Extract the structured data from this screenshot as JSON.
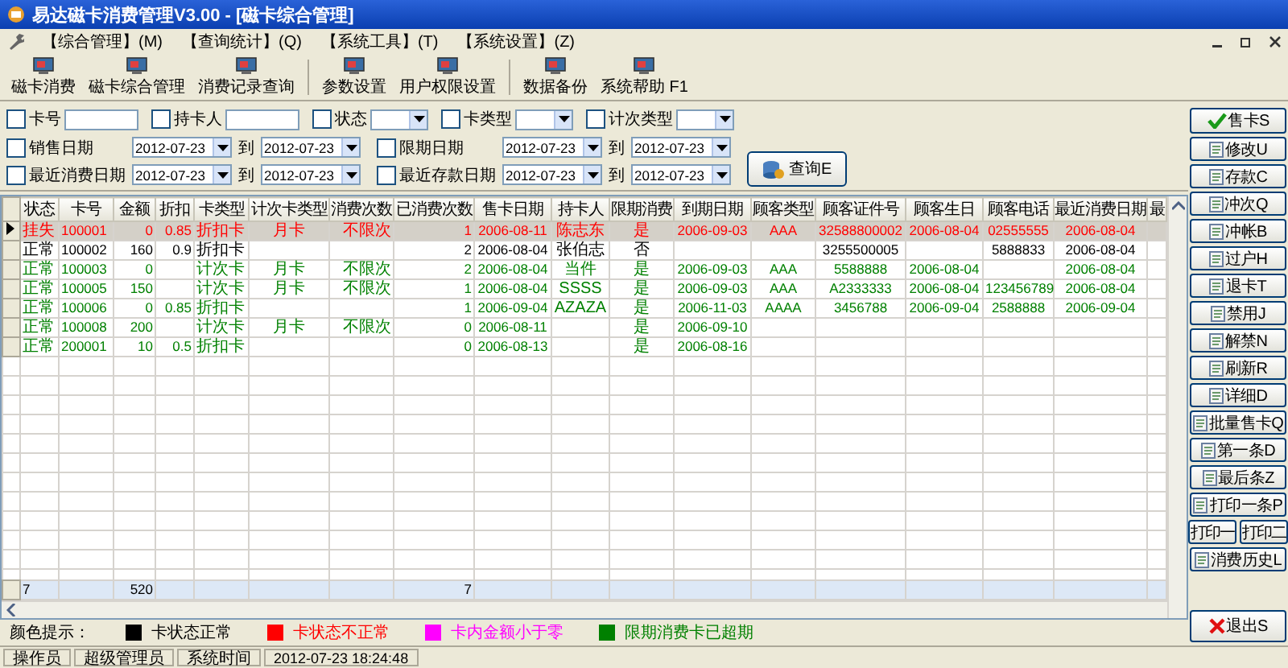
{
  "window": {
    "title": "易达磁卡消费管理V3.00 - [磁卡综合管理]"
  },
  "menu": [
    "【综合管理】(M)",
    "【查询统计】(Q)",
    "【系统工具】(T)",
    "【系统设置】(Z)"
  ],
  "toolbar_groups": [
    {
      "items": [
        "磁卡消费",
        "磁卡综合管理",
        "消费记录查询"
      ]
    },
    {
      "items": [
        "参数设置",
        "用户权限设置"
      ]
    },
    {
      "items": [
        "数据备份",
        "系统帮助 F1"
      ]
    }
  ],
  "filters": [
    {
      "kind": "text",
      "label": "卡号",
      "checked": false
    },
    {
      "kind": "text",
      "label": "持卡人",
      "checked": false
    },
    {
      "kind": "combo",
      "label": "状态",
      "checked": false
    },
    {
      "kind": "combo",
      "label": "卡类型",
      "checked": false
    },
    {
      "kind": "combo",
      "label": "计次类型",
      "checked": false
    }
  ],
  "date_filters": [
    {
      "label": "销售日期",
      "checked": false,
      "from": "2012-07-23",
      "to_label": "到",
      "to": "2012-07-23"
    },
    {
      "label": "限期日期",
      "checked": false,
      "from": "2012-07-23",
      "to_label": "到",
      "to": "2012-07-23"
    },
    {
      "label": "最近消费日期",
      "checked": false,
      "from": "2012-07-23",
      "to_label": "到",
      "to": "2012-07-23"
    },
    {
      "label": "最近存款日期",
      "checked": false,
      "from": "2012-07-23",
      "to_label": "到",
      "to": "2012-07-23"
    }
  ],
  "query_button": "查询E",
  "table": {
    "columns": [
      "状态",
      "卡号",
      "金额",
      "折扣",
      "卡类型",
      "计次卡类型",
      "消费次数",
      "已消费次数",
      "售卡日期",
      "持卡人",
      "限期消费",
      "到期日期",
      "顾客类型",
      "顾客证件号",
      "顾客生日",
      "顾客电话",
      "最近消费日期",
      "最"
    ],
    "rows": [
      {
        "color": "#ff0000",
        "selected": true,
        "status": "挂失",
        "card_no": "100001",
        "amount": "0",
        "discount": "0.85",
        "card_type": "折扣卡",
        "count_type": "月卡",
        "use_limit": "不限次",
        "used_count": "1",
        "sale_date": "2006-08-11",
        "holder": "陈志东",
        "time_limited": "是",
        "expiry_date": "2006-09-03",
        "customer_type": "AAA",
        "customer_id": "32588800002",
        "birthday": "2006-08-04",
        "phone": "02555555",
        "last_use_date": "2006-08-04"
      },
      {
        "color": "#000000",
        "selected": false,
        "status": "正常",
        "card_no": "100002",
        "amount": "160",
        "discount": "0.9",
        "card_type": "折扣卡",
        "used_count": "2",
        "sale_date": "2006-08-04",
        "holder": "张伯志",
        "time_limited": "否",
        "customer_id": "3255500005",
        "phone": "5888833",
        "last_use_date": "2006-08-04"
      },
      {
        "color": "#008000",
        "selected": false,
        "status": "正常",
        "card_no": "100003",
        "amount": "0",
        "card_type": "计次卡",
        "count_type": "月卡",
        "use_limit": "不限次",
        "used_count": "2",
        "sale_date": "2006-08-04",
        "holder": "当件",
        "time_limited": "是",
        "expiry_date": "2006-09-03",
        "customer_type": "AAA",
        "customer_id": "5588888",
        "birthday": "2006-08-04",
        "last_use_date": "2006-08-04"
      },
      {
        "color": "#008000",
        "selected": false,
        "status": "正常",
        "card_no": "100005",
        "amount": "150",
        "card_type": "计次卡",
        "count_type": "月卡",
        "use_limit": "不限次",
        "used_count": "1",
        "sale_date": "2006-08-04",
        "holder": "SSSS",
        "time_limited": "是",
        "expiry_date": "2006-09-03",
        "customer_type": "AAA",
        "customer_id": "A2333333",
        "birthday": "2006-08-04",
        "phone": "123456789",
        "last_use_date": "2006-08-04"
      },
      {
        "color": "#008000",
        "selected": false,
        "status": "正常",
        "card_no": "100006",
        "amount": "0",
        "discount": "0.85",
        "card_type": "折扣卡",
        "used_count": "1",
        "sale_date": "2006-09-04",
        "holder": "AZAZA",
        "time_limited": "是",
        "expiry_date": "2006-11-03",
        "customer_type": "AAAA",
        "customer_id": "3456788",
        "birthday": "2006-09-04",
        "phone": "2588888",
        "last_use_date": "2006-09-04"
      },
      {
        "color": "#008000",
        "selected": false,
        "status": "正常",
        "card_no": "100008",
        "amount": "200",
        "card_type": "计次卡",
        "count_type": "月卡",
        "use_limit": "不限次",
        "used_count": "0",
        "sale_date": "2006-08-11",
        "time_limited": "是",
        "expiry_date": "2006-09-10"
      },
      {
        "color": "#008000",
        "selected": false,
        "status": "正常",
        "card_no": "200001",
        "amount": "10",
        "discount": "0.5",
        "card_type": "折扣卡",
        "used_count": "0",
        "sale_date": "2006-08-13",
        "time_limited": "是",
        "expiry_date": "2006-08-16"
      }
    ],
    "footer": {
      "status": "7",
      "amount": "520",
      "used_count": "7"
    }
  },
  "legend": {
    "label": "颜色提示：",
    "items": [
      {
        "text": "卡状态正常",
        "color": "#000000"
      },
      {
        "text": "卡状态不正常",
        "color": "#ff0000"
      },
      {
        "text": "卡内金额小于零",
        "color": "#ff00ff"
      },
      {
        "text": "限期消费卡已超期",
        "color": "#008000"
      }
    ]
  },
  "side_buttons": [
    {
      "kind": "main",
      "label": "售卡S"
    },
    {
      "kind": "normal",
      "label": "修改U"
    },
    {
      "kind": "normal",
      "label": "存款C"
    },
    {
      "kind": "normal",
      "label": "冲次Q"
    },
    {
      "kind": "normal",
      "label": "冲帐B"
    },
    {
      "kind": "normal",
      "label": "过户H"
    },
    {
      "kind": "normal",
      "label": "退卡T"
    },
    {
      "kind": "normal",
      "label": "禁用J"
    },
    {
      "kind": "normal",
      "label": "解禁N"
    },
    {
      "kind": "normal",
      "label": "刷新R"
    },
    {
      "kind": "normal",
      "label": "详细D"
    },
    {
      "kind": "normal",
      "label": "批量售卡Q"
    },
    {
      "kind": "normal",
      "label": "第一条D"
    },
    {
      "kind": "normal",
      "label": "最后条Z"
    },
    {
      "kind": "normal",
      "label": "打印一条P"
    },
    {
      "kind": "pair",
      "labels": [
        "打印一",
        "打印二"
      ]
    },
    {
      "kind": "normal",
      "label": "消费历史L"
    }
  ],
  "exit_button": "退出S",
  "status_bar": [
    "操作员",
    "超级管理员",
    "系统时间",
    "2012-07-23 18:24:48"
  ]
}
